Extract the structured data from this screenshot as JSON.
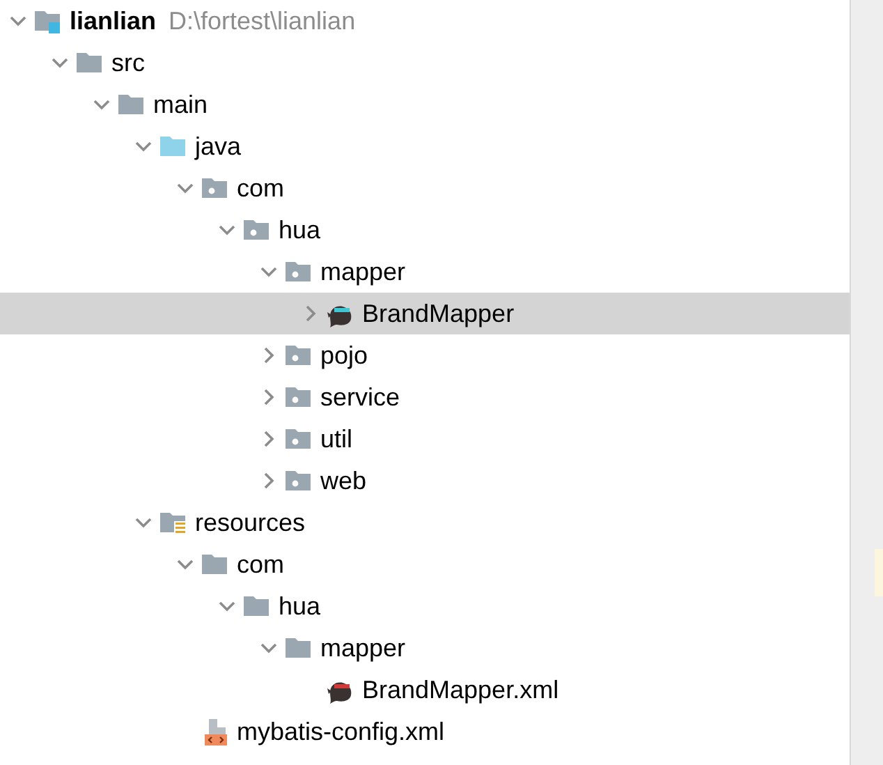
{
  "tree": [
    {
      "kind": "module",
      "label": "lianlian",
      "path": "D:\\fortest\\lianlian",
      "expanded": true,
      "selected": false,
      "children": [
        {
          "kind": "folder",
          "label": "src",
          "expanded": true,
          "selected": false,
          "children": [
            {
              "kind": "folder",
              "label": "main",
              "expanded": true,
              "selected": false,
              "children": [
                {
                  "kind": "source-folder",
                  "label": "java",
                  "expanded": true,
                  "selected": false,
                  "children": [
                    {
                      "kind": "package",
                      "label": "com",
                      "expanded": true,
                      "selected": false,
                      "children": [
                        {
                          "kind": "package",
                          "label": "hua",
                          "expanded": true,
                          "selected": false,
                          "children": [
                            {
                              "kind": "package",
                              "label": "mapper",
                              "expanded": true,
                              "selected": false,
                              "children": [
                                {
                                  "kind": "mapper-interface",
                                  "label": "BrandMapper",
                                  "expanded": false,
                                  "selected": true
                                }
                              ]
                            },
                            {
                              "kind": "package",
                              "label": "pojo",
                              "expanded": false,
                              "selected": false
                            },
                            {
                              "kind": "package",
                              "label": "service",
                              "expanded": false,
                              "selected": false
                            },
                            {
                              "kind": "package",
                              "label": "util",
                              "expanded": false,
                              "selected": false
                            },
                            {
                              "kind": "package",
                              "label": "web",
                              "expanded": false,
                              "selected": false
                            }
                          ]
                        }
                      ]
                    }
                  ]
                },
                {
                  "kind": "resource-folder",
                  "label": "resources",
                  "expanded": true,
                  "selected": false,
                  "children": [
                    {
                      "kind": "folder",
                      "label": "com",
                      "expanded": true,
                      "selected": false,
                      "children": [
                        {
                          "kind": "folder",
                          "label": "hua",
                          "expanded": true,
                          "selected": false,
                          "children": [
                            {
                              "kind": "folder",
                              "label": "mapper",
                              "expanded": true,
                              "selected": false,
                              "children": [
                                {
                                  "kind": "mapper-xml",
                                  "label": "BrandMapper.xml",
                                  "selected": false
                                }
                              ]
                            }
                          ]
                        }
                      ]
                    },
                    {
                      "kind": "xml-file",
                      "label": "mybatis-config.xml",
                      "selected": false
                    }
                  ]
                }
              ]
            }
          ]
        }
      ]
    }
  ]
}
